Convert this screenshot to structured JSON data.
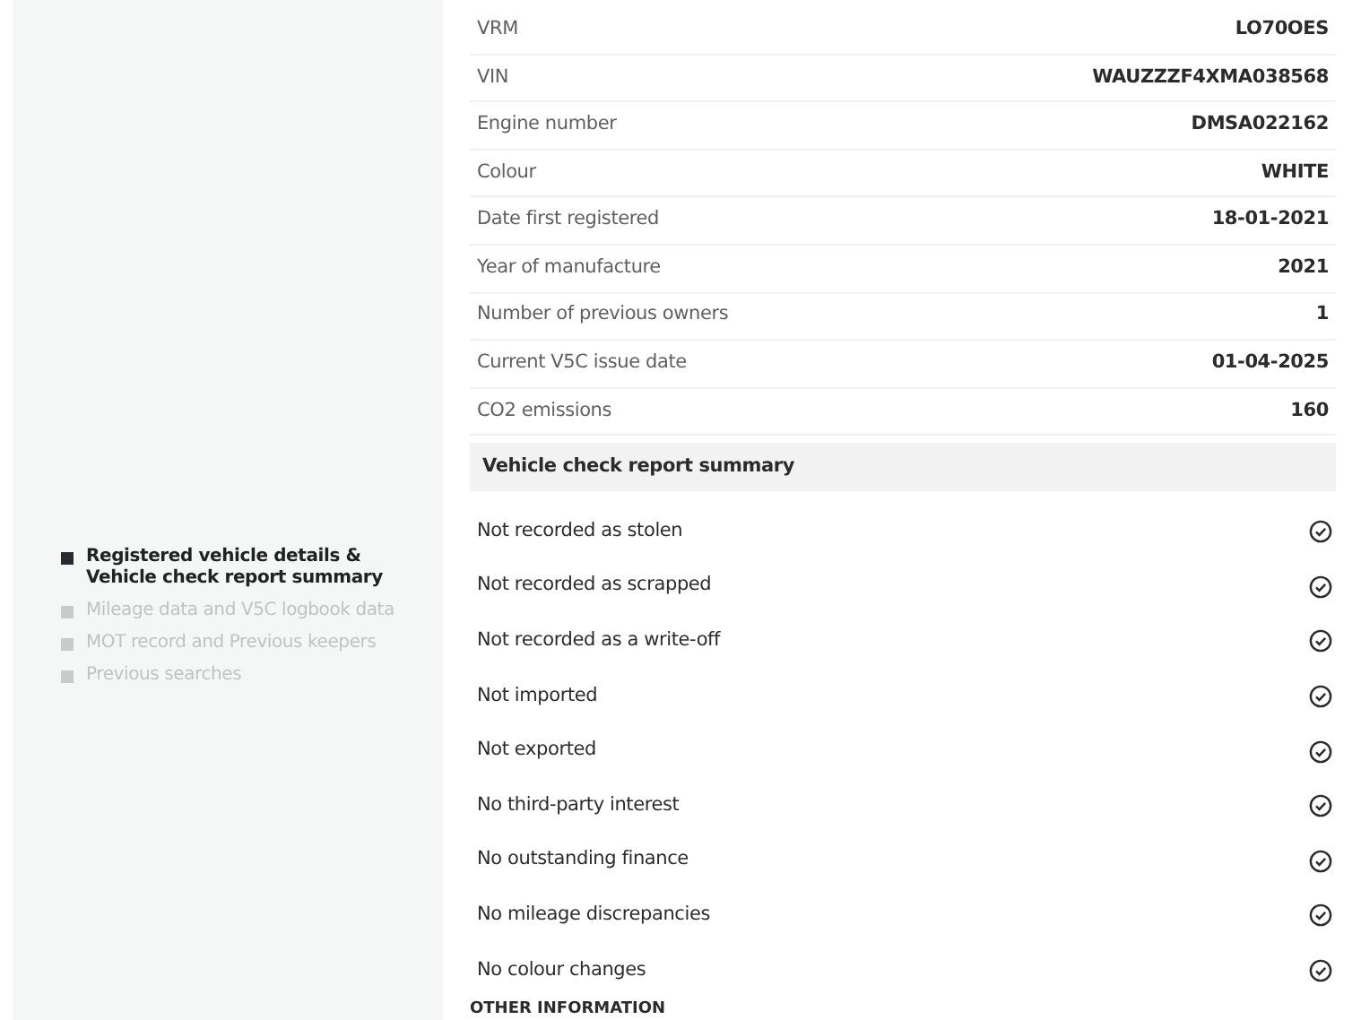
{
  "sidebar": {
    "items": [
      {
        "label": "Registered vehicle details & Vehicle check report summary",
        "selected": true
      },
      {
        "label": "Mileage data and V5C logbook data",
        "selected": false
      },
      {
        "label": "MOT record and Previous keepers",
        "selected": false
      },
      {
        "label": "Previous searches",
        "selected": false
      }
    ]
  },
  "details": [
    {
      "label": "VRM",
      "value": "LO70OES"
    },
    {
      "label": "VIN",
      "value": "WAUZZZF4XMA038568"
    },
    {
      "label": "Engine number",
      "value": "DMSA022162"
    },
    {
      "label": "Colour",
      "value": "WHITE"
    },
    {
      "label": "Date first registered",
      "value": "18-01-2021"
    },
    {
      "label": "Year of manufacture",
      "value": "2021"
    },
    {
      "label": "Number of previous owners",
      "value": "1"
    },
    {
      "label": "Current V5C issue date",
      "value": "01-04-2025"
    },
    {
      "label": "CO2 emissions",
      "value": "160"
    }
  ],
  "summary": {
    "title": "Vehicle check report summary",
    "checks": [
      {
        "label": "Not recorded as stolen",
        "passed": true
      },
      {
        "label": "Not recorded as scrapped",
        "passed": true
      },
      {
        "label": "Not recorded as a write-off",
        "passed": true
      },
      {
        "label": "Not imported",
        "passed": true
      },
      {
        "label": "Not exported",
        "passed": true
      },
      {
        "label": "No third-party interest",
        "passed": true
      },
      {
        "label": "No outstanding finance",
        "passed": true
      },
      {
        "label": "No mileage discrepancies",
        "passed": true
      },
      {
        "label": "No colour changes",
        "passed": true
      }
    ]
  },
  "next_section": {
    "title": "OTHER INFORMATION"
  }
}
